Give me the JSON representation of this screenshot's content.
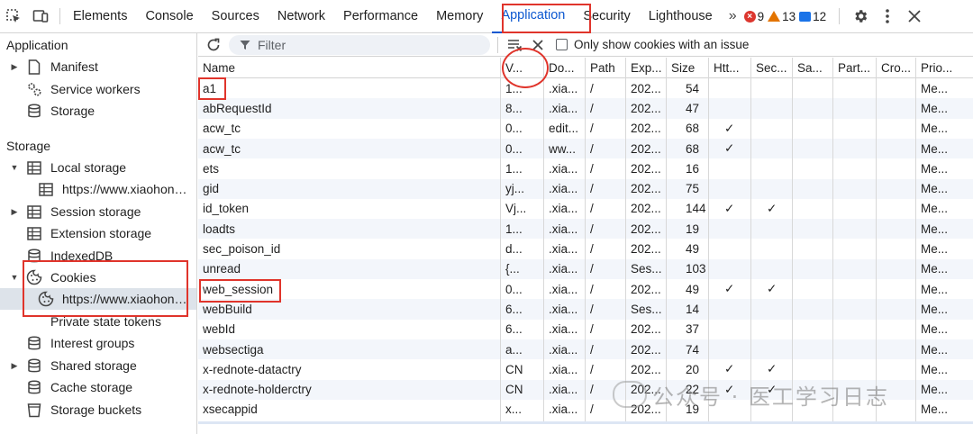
{
  "topbar": {
    "tabs": [
      "Elements",
      "Console",
      "Sources",
      "Network",
      "Performance",
      "Memory",
      "Application",
      "Security",
      "Lighthouse"
    ],
    "active_tab": "Application",
    "more": "»",
    "errors": "9",
    "warnings": "13",
    "messages": "12"
  },
  "sidebar": {
    "app_title": "Application",
    "storage_title": "Storage",
    "app_items": [
      "Manifest",
      "Service workers",
      "Storage"
    ],
    "storage_items": [
      "Local storage",
      "https://www.xiaohon…",
      "Session storage",
      "Extension storage",
      "IndexedDB",
      "Cookies",
      "https://www.xiaohon…",
      "Private state tokens",
      "Interest groups",
      "Shared storage",
      "Cache storage",
      "Storage buckets"
    ]
  },
  "toolbar": {
    "filter_placeholder": "Filter",
    "only_issue_label": "Only show cookies with an issue"
  },
  "table": {
    "columns": [
      "Name",
      "V...",
      "Do...",
      "Path",
      "Exp...",
      "Size",
      "Htt...",
      "Sec...",
      "Sa...",
      "Part...",
      "Cro...",
      "Prio..."
    ],
    "rows": [
      [
        "a1",
        "1...",
        ".xia...",
        "/",
        "202...",
        "54",
        "",
        "",
        "",
        "",
        "",
        "Me..."
      ],
      [
        "abRequestId",
        "8...",
        ".xia...",
        "/",
        "202...",
        "47",
        "",
        "",
        "",
        "",
        "",
        "Me..."
      ],
      [
        "acw_tc",
        "0...",
        "edit...",
        "/",
        "202...",
        "68",
        "✓",
        "",
        "",
        "",
        "",
        "Me..."
      ],
      [
        "acw_tc",
        "0...",
        "ww...",
        "/",
        "202...",
        "68",
        "✓",
        "",
        "",
        "",
        "",
        "Me..."
      ],
      [
        "ets",
        "1...",
        ".xia...",
        "/",
        "202...",
        "16",
        "",
        "",
        "",
        "",
        "",
        "Me..."
      ],
      [
        "gid",
        "yj...",
        ".xia...",
        "/",
        "202...",
        "75",
        "",
        "",
        "",
        "",
        "",
        "Me..."
      ],
      [
        "id_token",
        "Vj...",
        ".xia...",
        "/",
        "202...",
        "144",
        "✓",
        "✓",
        "",
        "",
        "",
        "Me..."
      ],
      [
        "loadts",
        "1...",
        ".xia...",
        "/",
        "202...",
        "19",
        "",
        "",
        "",
        "",
        "",
        "Me..."
      ],
      [
        "sec_poison_id",
        "d...",
        ".xia...",
        "/",
        "202...",
        "49",
        "",
        "",
        "",
        "",
        "",
        "Me..."
      ],
      [
        "unread",
        "{...",
        ".xia...",
        "/",
        "Ses...",
        "103",
        "",
        "",
        "",
        "",
        "",
        "Me..."
      ],
      [
        "web_session",
        "0...",
        ".xia...",
        "/",
        "202...",
        "49",
        "✓",
        "✓",
        "",
        "",
        "",
        "Me..."
      ],
      [
        "webBuild",
        "6...",
        ".xia...",
        "/",
        "Ses...",
        "14",
        "",
        "",
        "",
        "",
        "",
        "Me..."
      ],
      [
        "webId",
        "6...",
        ".xia...",
        "/",
        "202...",
        "37",
        "",
        "",
        "",
        "",
        "",
        "Me..."
      ],
      [
        "websectiga",
        "a...",
        ".xia...",
        "/",
        "202...",
        "74",
        "",
        "",
        "",
        "",
        "",
        "Me..."
      ],
      [
        "x-rednote-datactry",
        "CN",
        ".xia...",
        "/",
        "202...",
        "20",
        "✓",
        "✓",
        "",
        "",
        "",
        "Me..."
      ],
      [
        "x-rednote-holderctry",
        "CN",
        ".xia...",
        "/",
        "202...",
        "22",
        "✓",
        "✓",
        "",
        "",
        "",
        "Me..."
      ],
      [
        "xsecappid",
        "x...",
        ".xia...",
        "/",
        "202...",
        "19",
        "",
        "",
        "",
        "",
        "",
        "Me..."
      ]
    ]
  },
  "watermark": {
    "text": "公众号 · 医工学习日志"
  },
  "colors": {
    "accent": "#0b57d0",
    "highlight": "#e0342b",
    "row_alt": "#f3f6fb",
    "selected": "#dde3ea"
  }
}
